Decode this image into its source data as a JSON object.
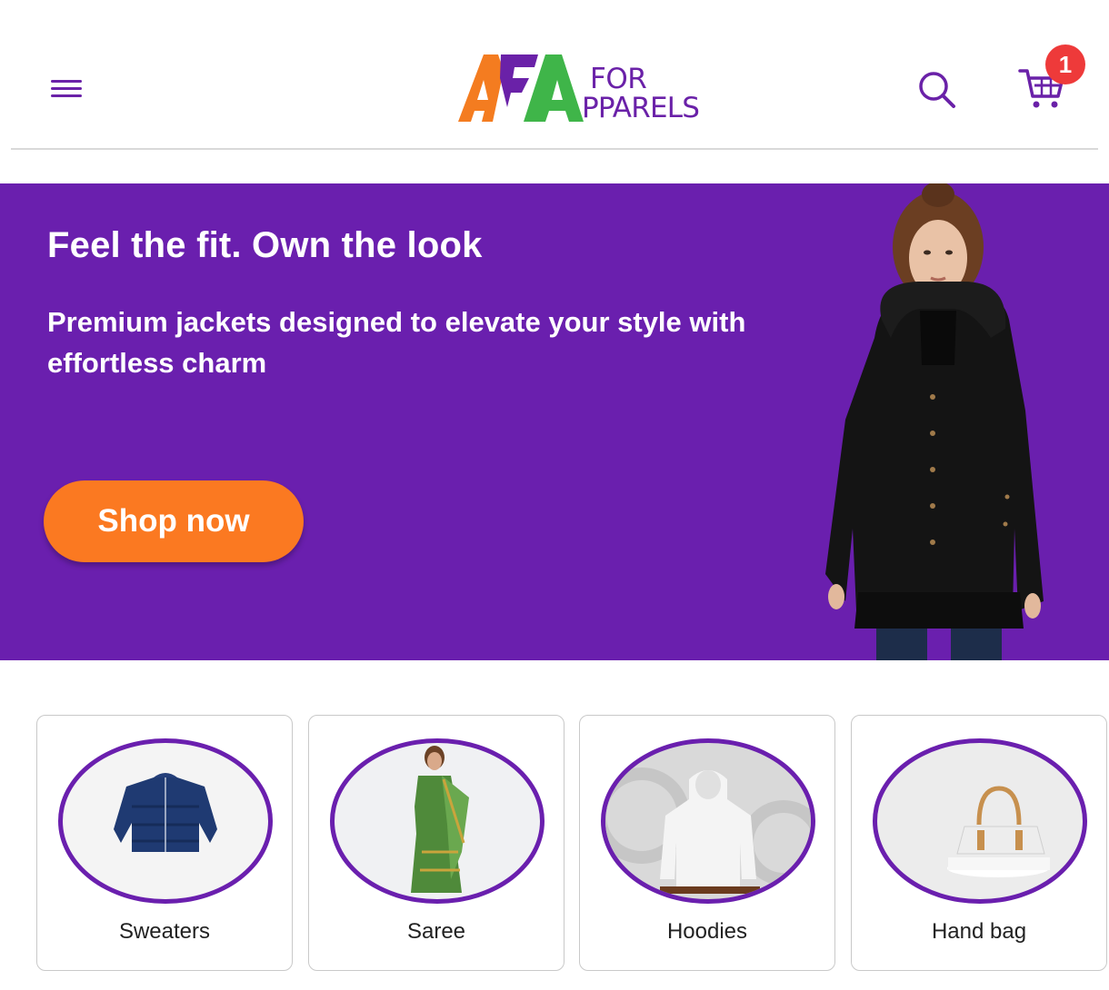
{
  "header": {
    "menu_icon": "hamburger-menu-icon",
    "logo": {
      "mark": "AFA",
      "line1": "FOR",
      "line2": "PPARELS"
    },
    "search_icon": "search-icon",
    "cart_icon": "cart-icon",
    "cart_count": "1"
  },
  "hero": {
    "title": "Feel the fit. Own the look",
    "subtitle": "Premium jackets designed to elevate your style with effortless charm",
    "cta_label": "Shop now",
    "background_color": "#6a1fae",
    "cta_color": "#fb7921"
  },
  "categories": [
    {
      "label": "Sweaters",
      "image": "puffer-jacket-image"
    },
    {
      "label": "Saree",
      "image": "saree-model-image"
    },
    {
      "label": "Hoodies",
      "image": "white-hoodie-image"
    },
    {
      "label": "Hand bag",
      "image": "handbag-image"
    }
  ],
  "colors": {
    "brand_purple": "#6a21a8",
    "logo_orange": "#f47c20",
    "logo_green": "#3fb549",
    "badge_red": "#ee3a3a"
  }
}
